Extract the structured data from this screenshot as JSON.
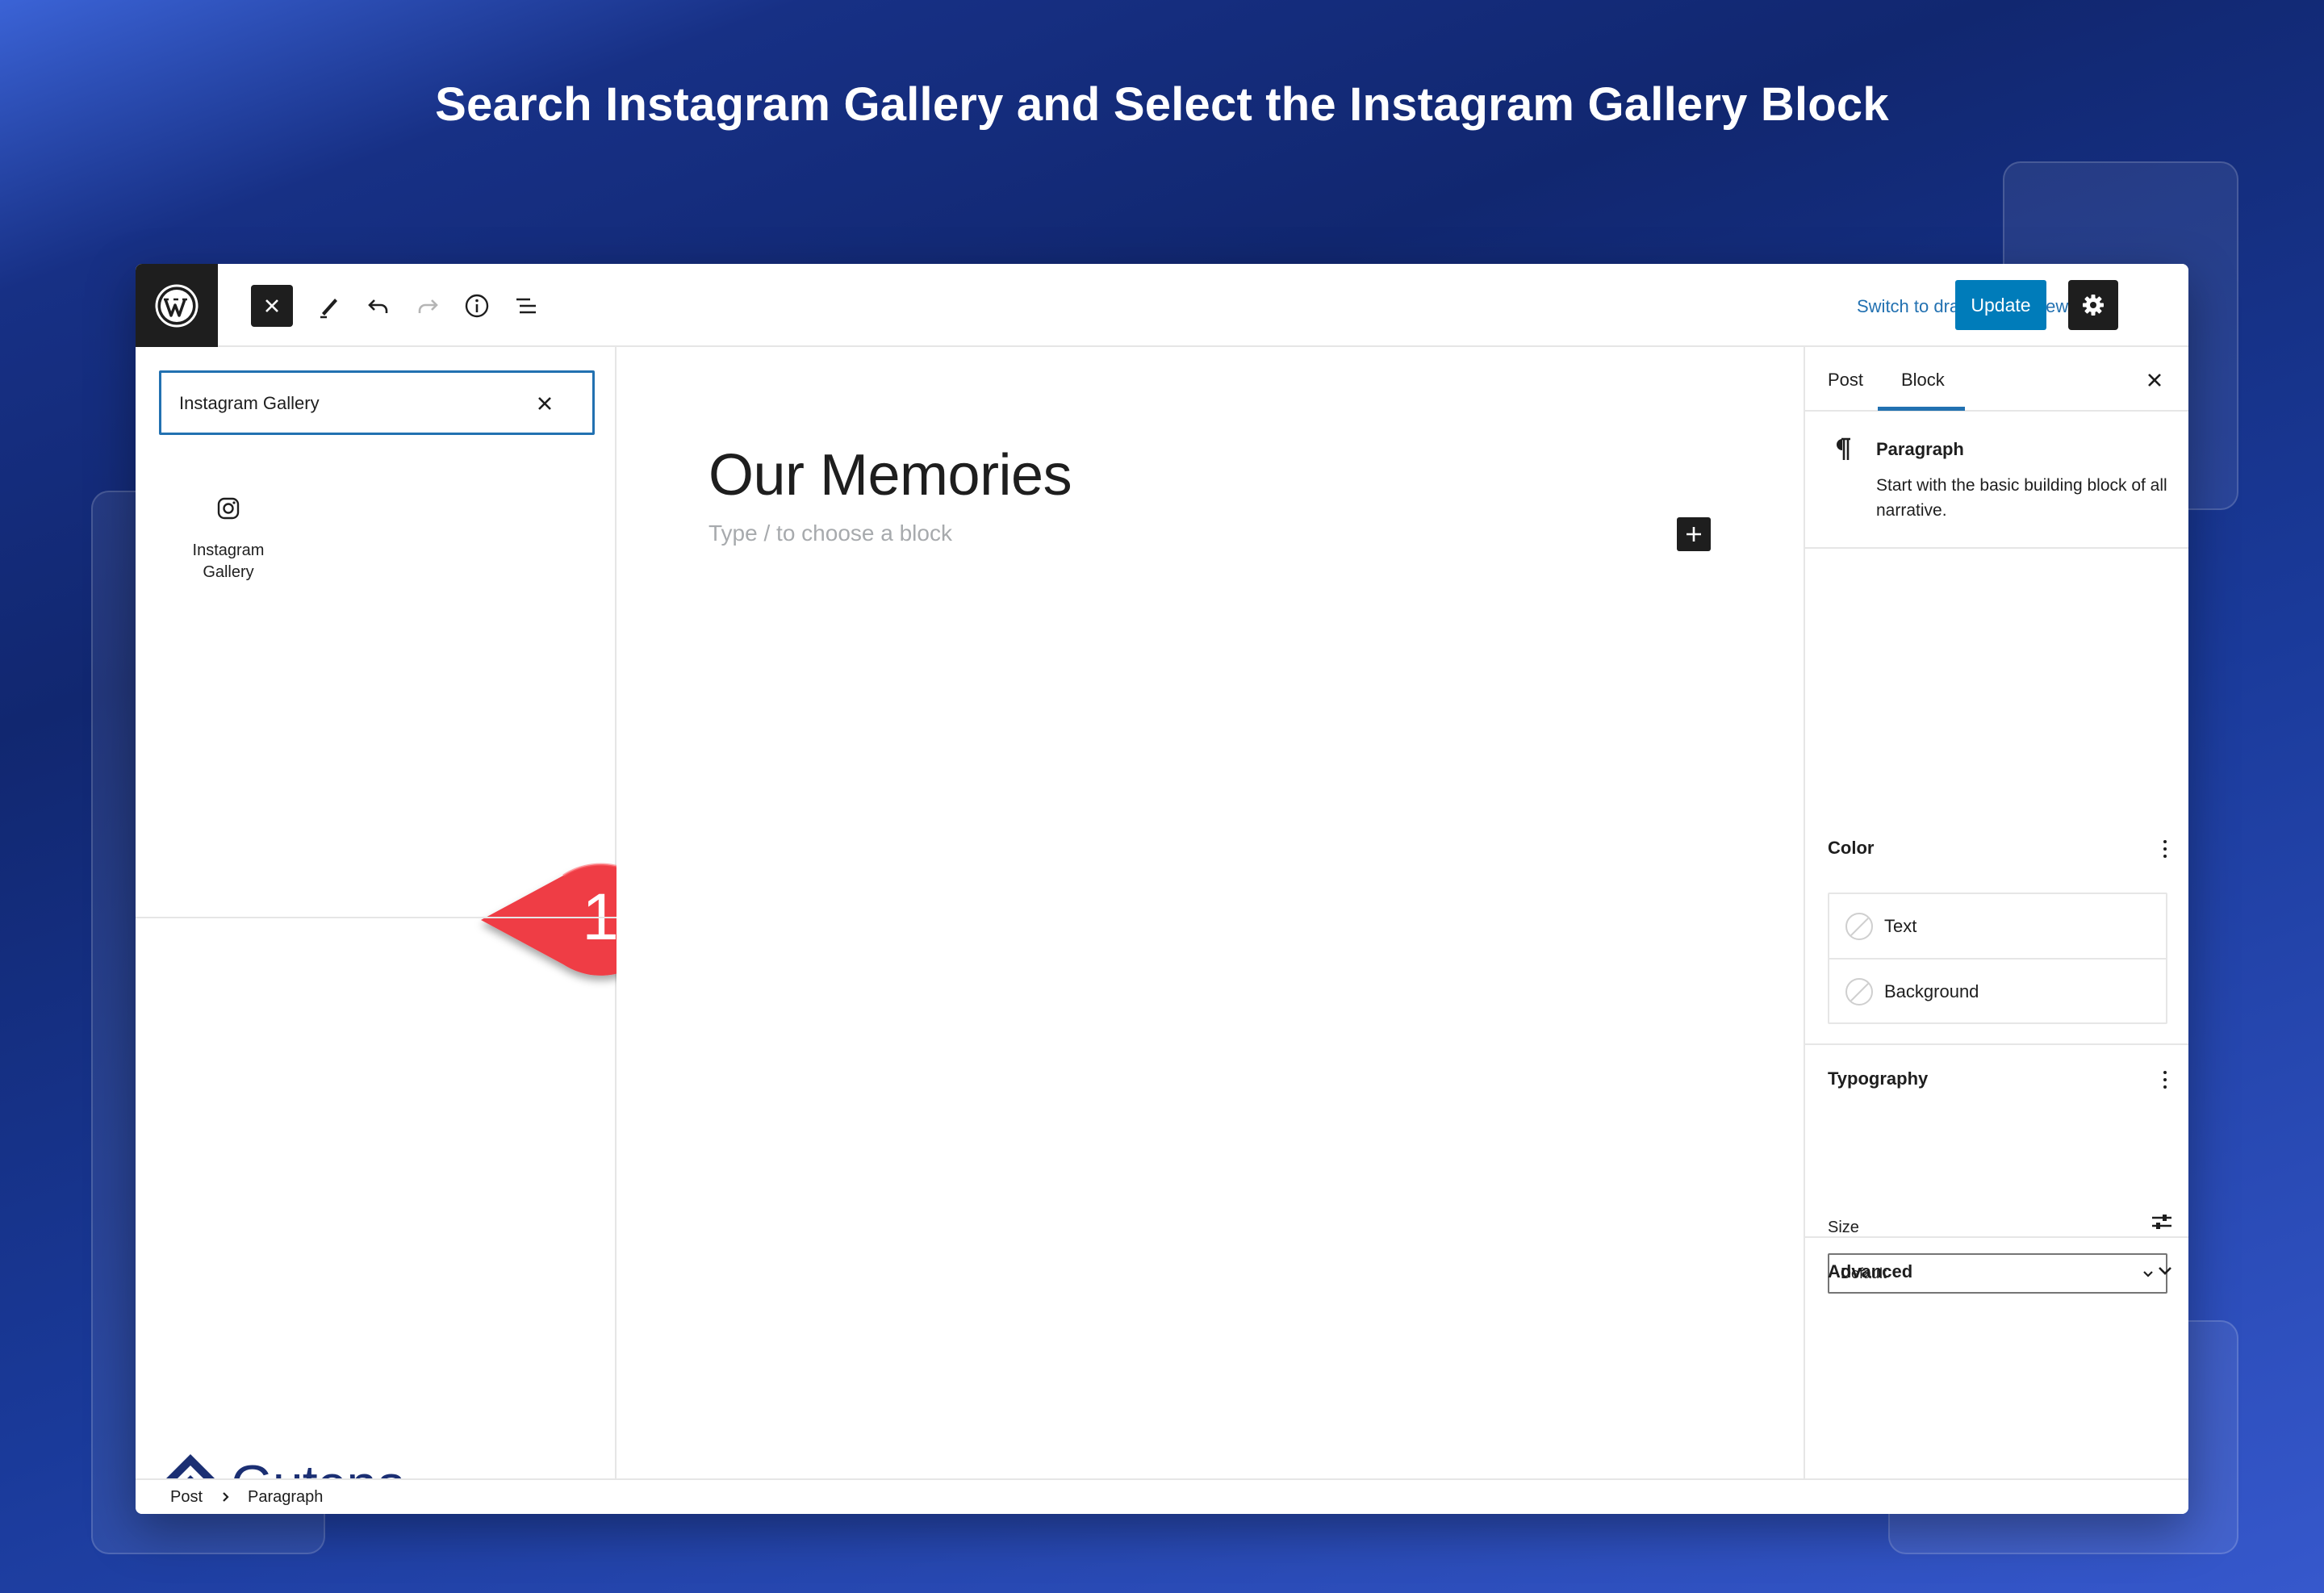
{
  "headline": "Search Instagram Gallery and Select the Instagram Gallery Block",
  "colors": {
    "accent": "#2271b1",
    "update_button": "#007cba",
    "dark": "#1e1e1e",
    "callout": "#ef3c45",
    "brand": "#1b2f73"
  },
  "toolbar": {
    "icons": [
      "wordpress-logo",
      "close-icon",
      "pencil-icon",
      "undo-icon",
      "redo-icon",
      "info-icon",
      "list-view-icon"
    ],
    "switch_to_draft": "Switch to draft",
    "preview": "Preview",
    "update": "Update"
  },
  "inserter": {
    "search_value": "Instagram Gallery",
    "result": {
      "label": "Instagram Gallery",
      "icon": "instagram-icon"
    },
    "callout_number": "1"
  },
  "brand": {
    "name": "Gutena."
  },
  "editor": {
    "title": "Our Memories",
    "placeholder": "Type / to choose a block"
  },
  "sidebar": {
    "tabs": [
      "Post",
      "Block"
    ],
    "active_tab": "Block",
    "block": {
      "name": "Paragraph",
      "description": "Start with the basic building block of all narrative."
    },
    "color": {
      "title": "Color",
      "items": [
        "Text",
        "Background"
      ]
    },
    "typography": {
      "title": "Typography",
      "size_label": "Size",
      "size_value": "Default"
    },
    "advanced": {
      "title": "Advanced"
    }
  },
  "breadcrumb": {
    "items": [
      "Post",
      "Paragraph"
    ]
  }
}
